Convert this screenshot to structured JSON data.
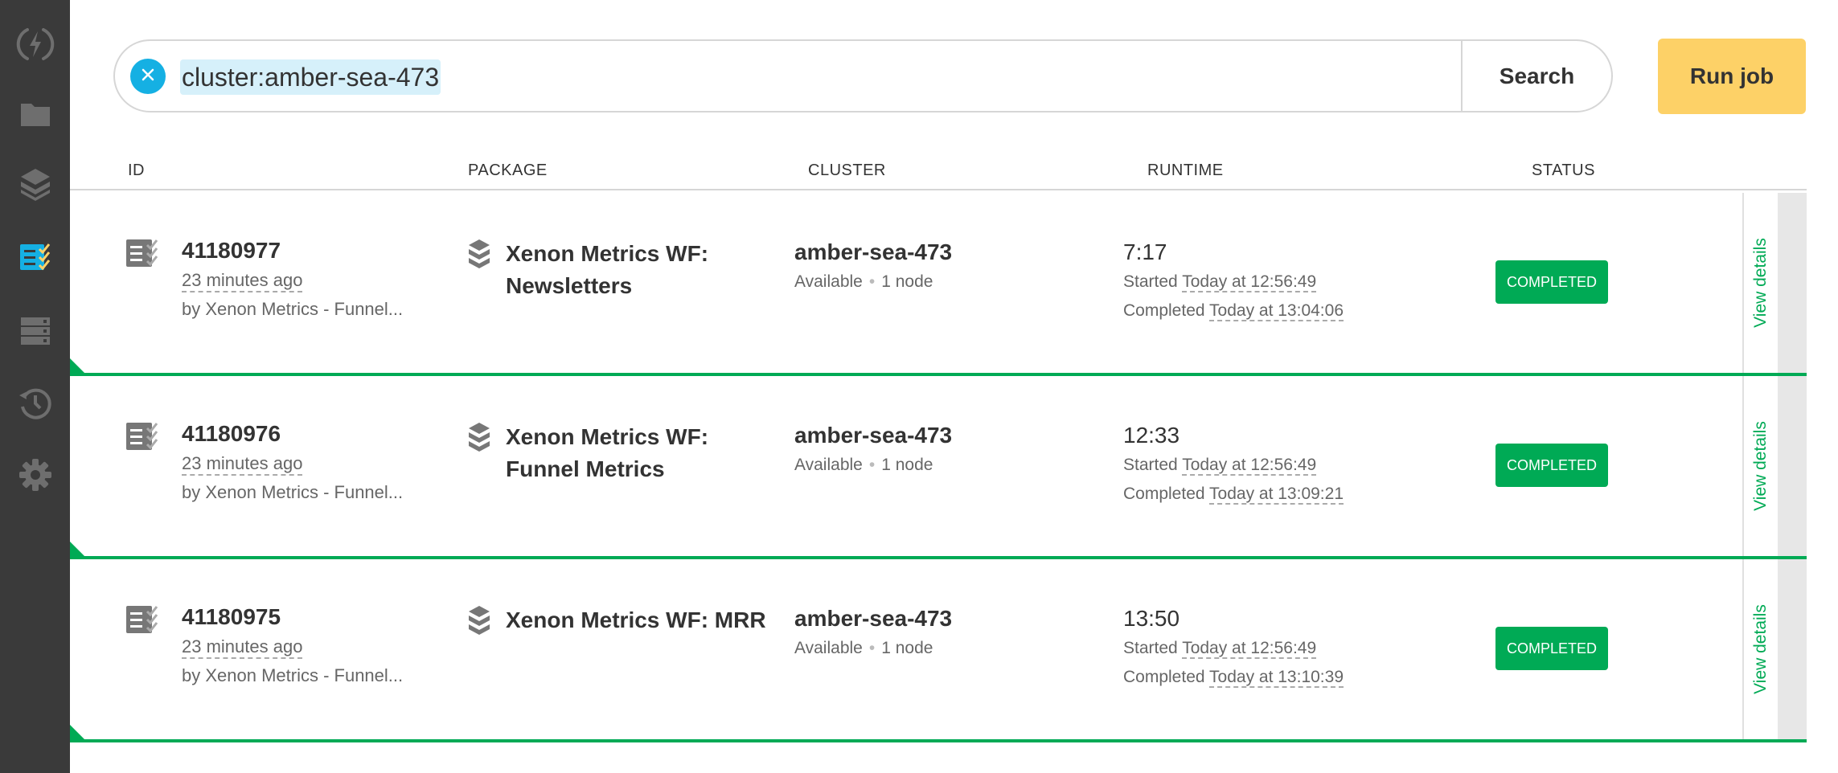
{
  "sidebar": {
    "items": [
      {
        "name": "lightning-icon"
      },
      {
        "name": "folder-icon"
      },
      {
        "name": "packages-icon"
      },
      {
        "name": "jobs-icon",
        "active": true
      },
      {
        "name": "clusters-icon"
      },
      {
        "name": "history-icon"
      },
      {
        "name": "gear-icon"
      }
    ],
    "colors": {
      "background": "#3a3a3a",
      "icon": "#6e6e6e",
      "active": "#15b0e3",
      "active_check": "#fdd167"
    }
  },
  "search": {
    "query": "cluster:amber-sea-473",
    "button_label": "Search"
  },
  "toolbar": {
    "run_job_label": "Run job"
  },
  "table": {
    "columns": {
      "id": "ID",
      "package": "PACKAGE",
      "cluster": "CLUSTER",
      "runtime": "RUNTIME",
      "status": "STATUS"
    },
    "rows": [
      {
        "id": "41180977",
        "age": "23 minutes ago",
        "by": "by Xenon Metrics - Funnel...",
        "package": "Xenon Metrics WF: Newsletters",
        "cluster": "amber-sea-473",
        "cluster_state": "Available",
        "cluster_nodes": "1 node",
        "runtime": "7:17",
        "started_label": "Started",
        "started": "Today at 12:56:49",
        "completed_label": "Completed",
        "completed": "Today at 13:04:06",
        "status": "COMPLETED",
        "view_details": "View details"
      },
      {
        "id": "41180976",
        "age": "23 minutes ago",
        "by": "by Xenon Metrics - Funnel...",
        "package": "Xenon Metrics WF: Funnel Metrics",
        "cluster": "amber-sea-473",
        "cluster_state": "Available",
        "cluster_nodes": "1 node",
        "runtime": "12:33",
        "started_label": "Started",
        "started": "Today at 12:56:49",
        "completed_label": "Completed",
        "completed": "Today at 13:09:21",
        "status": "COMPLETED",
        "view_details": "View details"
      },
      {
        "id": "41180975",
        "age": "23 minutes ago",
        "by": "by Xenon Metrics - Funnel...",
        "package": "Xenon Metrics WF: MRR",
        "cluster": "amber-sea-473",
        "cluster_state": "Available",
        "cluster_nodes": "1 node",
        "runtime": "13:50",
        "started_label": "Started",
        "started": "Today at 12:56:49",
        "completed_label": "Completed",
        "completed": "Today at 13:10:39",
        "status": "COMPLETED",
        "view_details": "View details"
      }
    ]
  },
  "colors": {
    "accent": "#15b0e3",
    "status_completed": "#00aa55",
    "run_button": "#fdd167"
  }
}
